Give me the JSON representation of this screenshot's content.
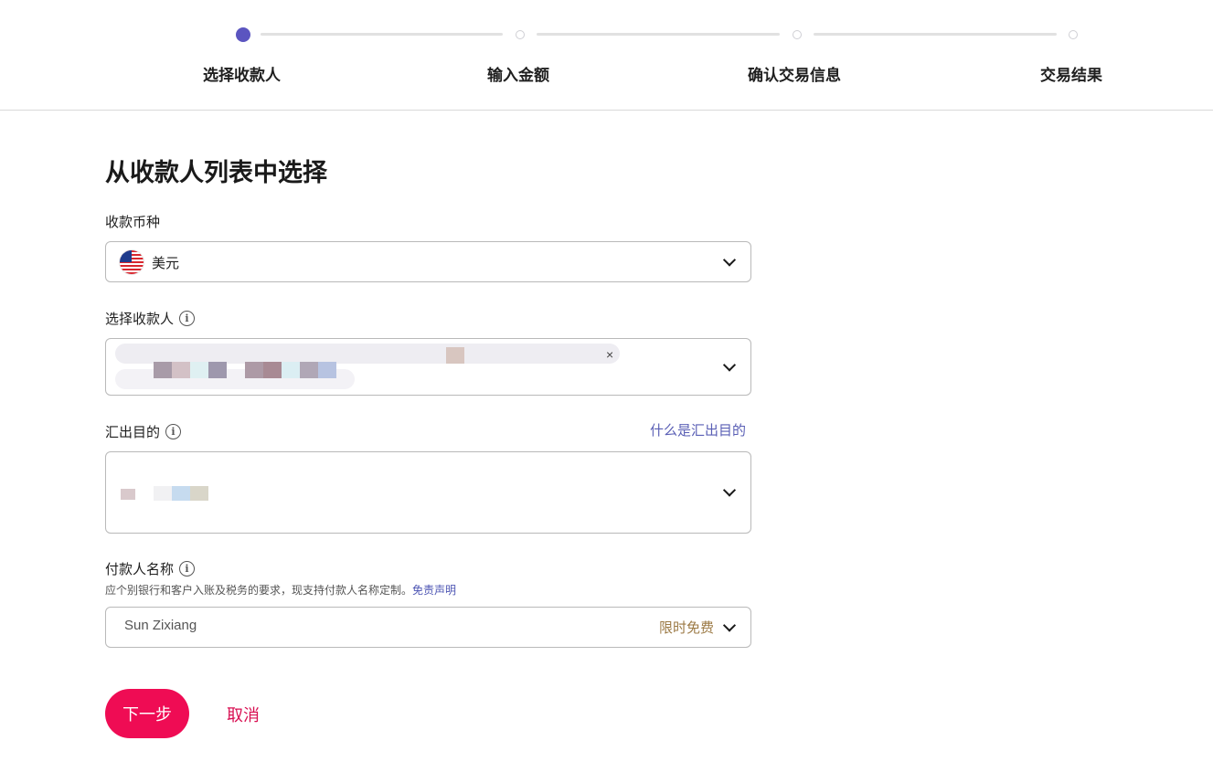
{
  "stepper": {
    "steps": [
      {
        "label": "选择收款人",
        "state": "active"
      },
      {
        "label": "输入金额",
        "state": "pending"
      },
      {
        "label": "确认交易信息",
        "state": "pending"
      },
      {
        "label": "交易结果",
        "state": "pending"
      }
    ]
  },
  "form": {
    "title": "从收款人列表中选择",
    "currency": {
      "label": "收款币种",
      "value": "美元",
      "flag_icon": "us-flag-icon"
    },
    "payee": {
      "label": "选择收款人",
      "remove_glyph": "×"
    },
    "purpose": {
      "label": "汇出目的",
      "help_link": "什么是汇出目的"
    },
    "payer": {
      "label": "付款人名称",
      "note": "应个别银行和客户入账及税务的要求，现支持付款人名称定制。",
      "note_link": "免责声明",
      "value": "Sun Zixiang",
      "badge": "限时免费"
    }
  },
  "actions": {
    "next_label": "下一步",
    "cancel_label": "取消"
  },
  "colors": {
    "accent": "#5b55c0",
    "primary_button": "#ef0c54",
    "link": "#5a5fb5",
    "badge": "#9c7a45"
  }
}
